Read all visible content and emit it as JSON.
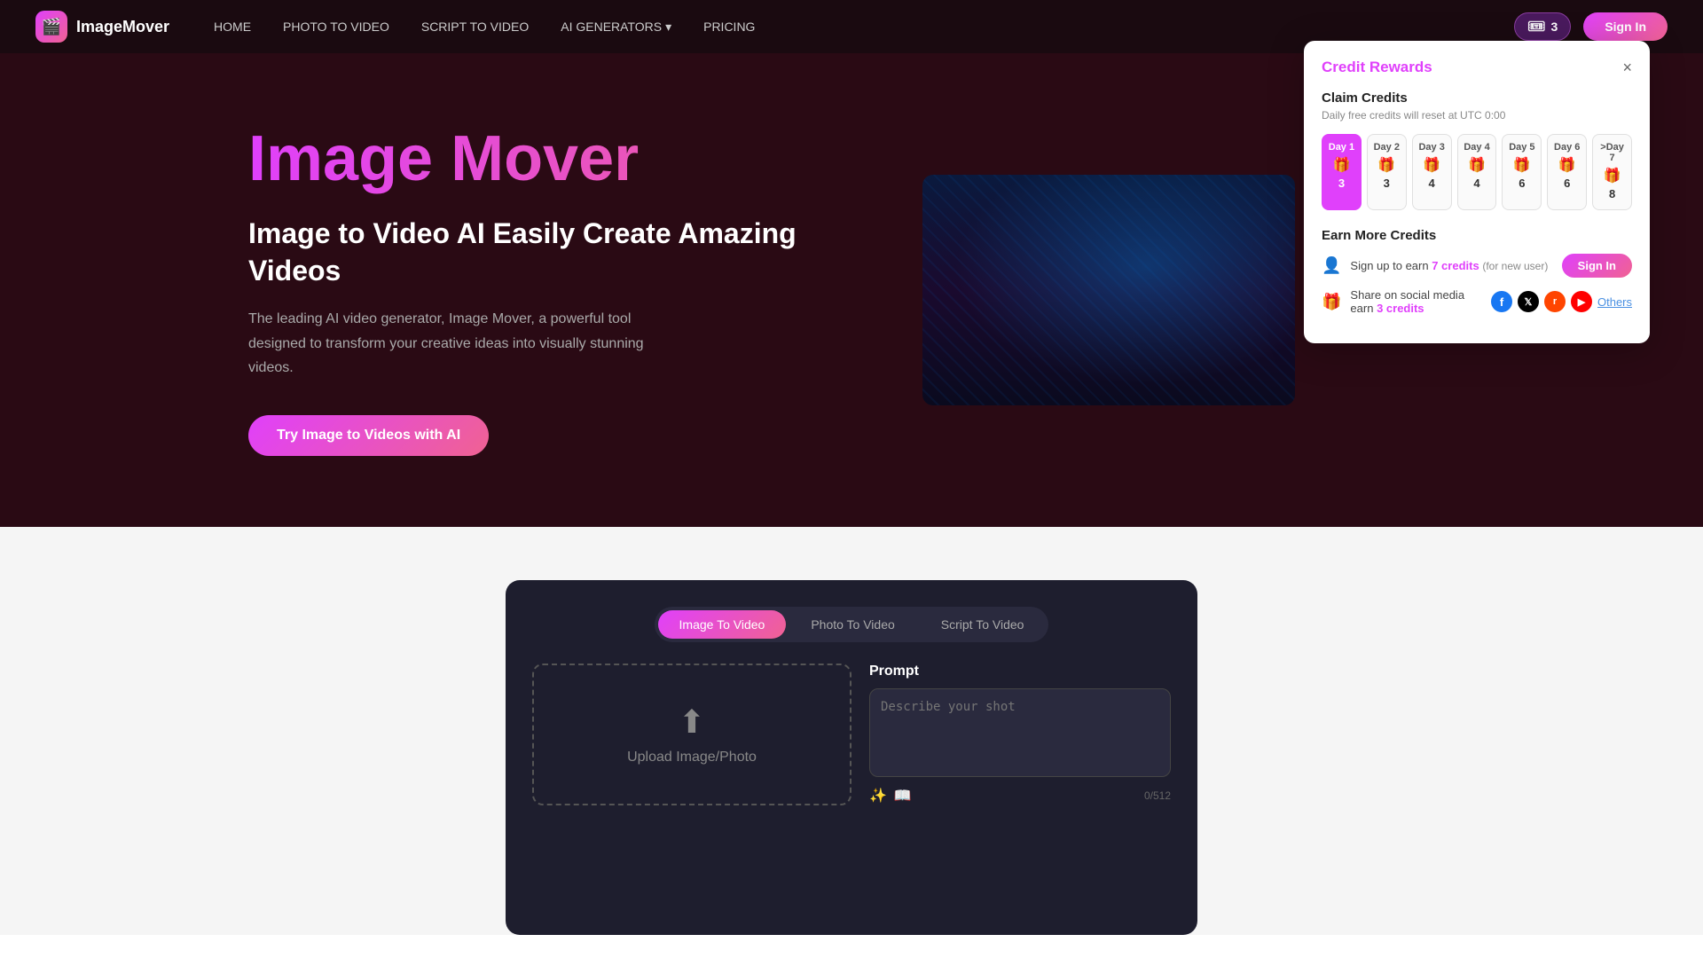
{
  "navbar": {
    "logo_text": "ImageMover",
    "links": [
      {
        "label": "HOME",
        "id": "home"
      },
      {
        "label": "PHOTO TO VIDEO",
        "id": "photo-to-video"
      },
      {
        "label": "SCRIPT TO VIDEO",
        "id": "script-to-video"
      },
      {
        "label": "AI GENERATORS",
        "id": "ai-generators",
        "has_dropdown": true
      },
      {
        "label": "PRICING",
        "id": "pricing"
      }
    ],
    "credits_count": "3",
    "signin_label": "Sign In"
  },
  "hero": {
    "title": "Image Mover",
    "subtitle": "Image to Video AI Easily Create Amazing Videos",
    "description": "The leading AI video generator, Image Mover, a powerful tool designed to transform your creative ideas into visually stunning videos.",
    "cta_label": "Try Image to Videos with AI"
  },
  "credit_popup": {
    "title": "Credit Rewards",
    "close_label": "×",
    "claim_title": "Claim Credits",
    "claim_subtitle": "Daily free credits will reset at UTC 0:00",
    "days": [
      {
        "label": "Day 1",
        "icon": "🎁",
        "num": "3",
        "active": true
      },
      {
        "label": "Day 2",
        "icon": "🎁",
        "num": "3",
        "active": false
      },
      {
        "label": "Day 3",
        "icon": "🎁",
        "num": "4",
        "active": false
      },
      {
        "label": "Day 4",
        "icon": "🎁",
        "num": "4",
        "active": false
      },
      {
        "label": "Day 5",
        "icon": "🎁",
        "num": "6",
        "active": false
      },
      {
        "label": "Day 6",
        "icon": "🎁",
        "num": "6",
        "active": false
      },
      {
        "label": ">Day 7",
        "icon": "🎁",
        "num": "8",
        "active": false
      }
    ],
    "earn_title": "Earn More Credits",
    "earn_rows": [
      {
        "icon": "👤",
        "text_prefix": "Sign up to earn ",
        "credits_label": "7 credits",
        "text_suffix": " (for new user)",
        "action": "sign_in",
        "action_label": "Sign In"
      },
      {
        "icon": "🎁",
        "text_prefix": "Share on social media earn ",
        "credits_label": "3 credits",
        "text_suffix": "",
        "action": "social",
        "social_platforms": [
          "Facebook",
          "X",
          "Reddit",
          "YouTube"
        ],
        "others_label": "Others"
      }
    ]
  },
  "tool_panel": {
    "tabs": [
      {
        "label": "Image To Video",
        "active": true
      },
      {
        "label": "Photo To Video",
        "active": false
      },
      {
        "label": "Script To Video",
        "active": false
      }
    ],
    "upload": {
      "placeholder_text": "Upload Image/Photo"
    },
    "prompt": {
      "label": "Prompt",
      "placeholder": "Describe your shot",
      "char_count": "0/512"
    }
  }
}
